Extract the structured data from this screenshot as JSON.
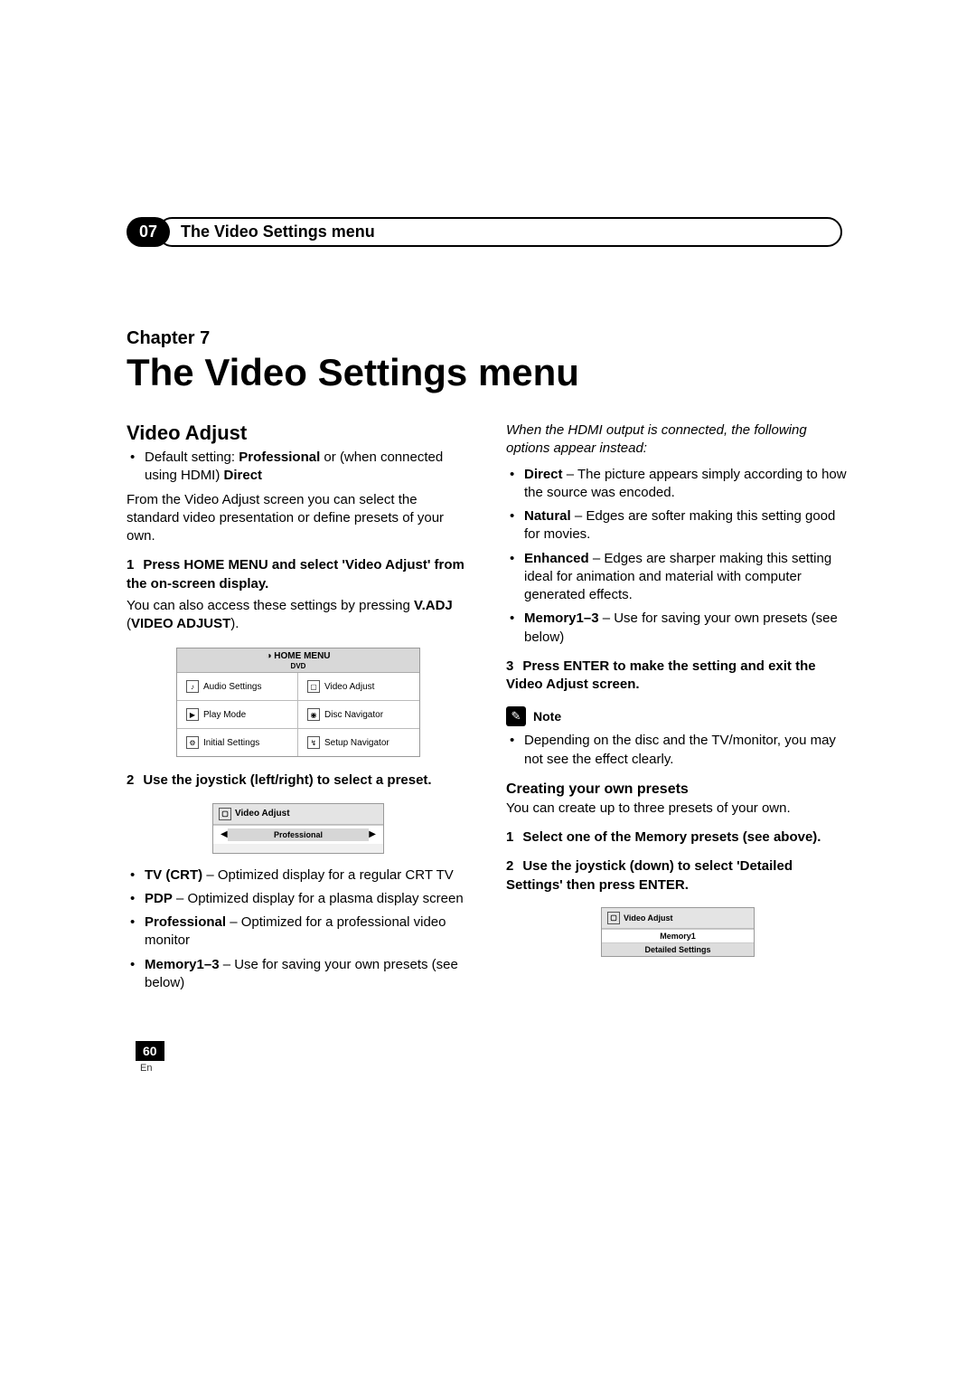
{
  "header": {
    "chapter_num": "07",
    "pill_title": "The Video Settings menu"
  },
  "title": {
    "chapter_label": "Chapter 7",
    "chapter_title": "The Video Settings menu"
  },
  "left": {
    "heading": "Video Adjust",
    "default_prefix": "Default setting: ",
    "default_bold1": "Professional",
    "default_mid": " or (when connected using HDMI) ",
    "default_bold2": "Direct",
    "intro": "From the Video Adjust screen you can select the standard video presentation or define presets of your own.",
    "step1_num": "1",
    "step1_title": "Press HOME MENU and select 'Video Adjust' from the on-screen display.",
    "step1_body_a": "You can also access these settings by pressing ",
    "step1_body_b": "V.ADJ",
    "step1_body_c": " (",
    "step1_body_d": "VIDEO ADJUST",
    "step1_body_e": ").",
    "menu": {
      "title": "HOME MENU",
      "sub": "DVD",
      "items": [
        "Audio Settings",
        "Video Adjust",
        "Play Mode",
        "Disc Navigator",
        "Initial Settings",
        "Setup Navigator"
      ]
    },
    "step2_num": "2",
    "step2_title": "Use the joystick (left/right) to select a preset.",
    "va": {
      "header": "Video Adjust",
      "selected": "Professional"
    },
    "presets": [
      {
        "b": "TV (CRT)",
        "t": " – Optimized display for a regular CRT TV"
      },
      {
        "b": "PDP",
        "t": " – Optimized display for a plasma display screen"
      },
      {
        "b": "Professional",
        "t": " – Optimized for a professional video monitor"
      },
      {
        "b": "Memory1–3",
        "t": " – Use for saving your own presets (see below)"
      }
    ]
  },
  "right": {
    "hdmi_note": "When the HDMI output is connected, the following options appear instead:",
    "hdmi_opts": [
      {
        "b": "Direct",
        "t": " – The picture appears simply according to how the source was encoded."
      },
      {
        "b": "Natural",
        "t": " – Edges are softer making this setting good for movies."
      },
      {
        "b": "Enhanced",
        "t": " – Edges are sharper making this setting ideal for animation and material with computer generated effects."
      },
      {
        "b": "Memory1–3",
        "t": " – Use for saving your own presets (see below)"
      }
    ],
    "step3_num": "3",
    "step3_title": "Press ENTER to make the setting and exit the Video Adjust screen.",
    "note_label": "Note",
    "note_body": "Depending on the disc and the TV/monitor, you may not see the effect clearly.",
    "create_heading": "Creating your own presets",
    "create_intro": "You can create up to three presets of your own.",
    "cstep1_num": "1",
    "cstep1_title": "Select one of the Memory presets (see above).",
    "cstep2_num": "2",
    "cstep2_title": "Use the joystick (down) to select 'Detailed Settings' then press ENTER.",
    "mem": {
      "header": "Video Adjust",
      "row1": "Memory1",
      "row2": "Detailed Settings"
    }
  },
  "footer": {
    "page": "60",
    "lang": "En"
  }
}
